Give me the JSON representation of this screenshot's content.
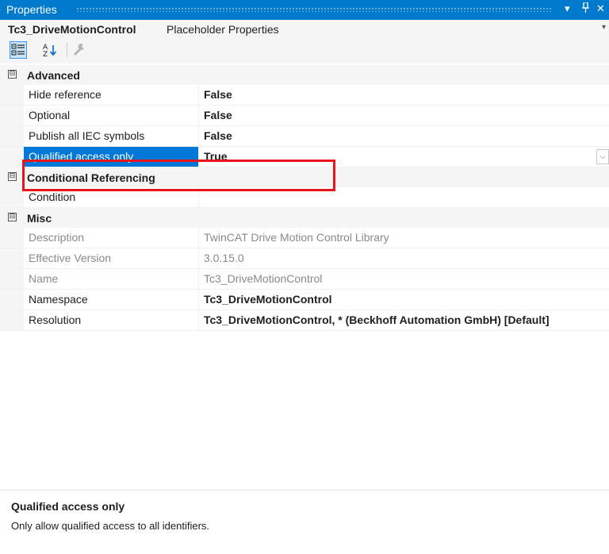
{
  "window": {
    "title": "Properties",
    "controls": {
      "dropdown_glyph": "▾",
      "pin_glyph": "ᵖ",
      "close_glyph": "✕"
    }
  },
  "object_selector": {
    "name": "Tc3_DriveMotionControl",
    "type": "Placeholder Properties"
  },
  "toolbar": {
    "buttons": [
      {
        "icon": "categorized-icon",
        "active": true
      },
      {
        "icon": "alphabetical-sort-icon",
        "active": false
      },
      {
        "icon": "property-pages-wrench-icon",
        "active": false
      }
    ]
  },
  "categories": [
    {
      "label": "Advanced",
      "toggle": "⊟",
      "rows": [
        {
          "name": "Hide reference",
          "value": "False",
          "bold": true
        },
        {
          "name": "Optional",
          "value": "False",
          "bold": true
        },
        {
          "name": "Publish all IEC symbols",
          "value": "False",
          "bold": true
        },
        {
          "name": "Qualified access only",
          "value": "True",
          "bold": true,
          "selected": true
        }
      ]
    },
    {
      "label": "Conditional Referencing",
      "toggle": "⊟",
      "rows": [
        {
          "name": "Condition",
          "value": ""
        }
      ]
    },
    {
      "label": "Misc",
      "toggle": "⊟",
      "rows": [
        {
          "name": "Description",
          "value": "TwinCAT Drive Motion Control Library",
          "readonly": true
        },
        {
          "name": "Effective Version",
          "value": "3.0.15.0",
          "readonly": true
        },
        {
          "name": "Name",
          "value": "Tc3_DriveMotionControl",
          "readonly": true
        },
        {
          "name": "Namespace",
          "value": "Tc3_DriveMotionControl",
          "bold": true
        },
        {
          "name": "Resolution",
          "value": "Tc3_DriveMotionControl, * (Beckhoff Automation GmbH) [Default]",
          "bold": true
        }
      ]
    }
  ],
  "description_panel": {
    "title": "Qualified access only",
    "text": "Only allow qualified access to all identifiers."
  },
  "colors": {
    "title_bar": "#007acc",
    "selection": "#0078d7",
    "highlight_box": "#e8151c"
  }
}
